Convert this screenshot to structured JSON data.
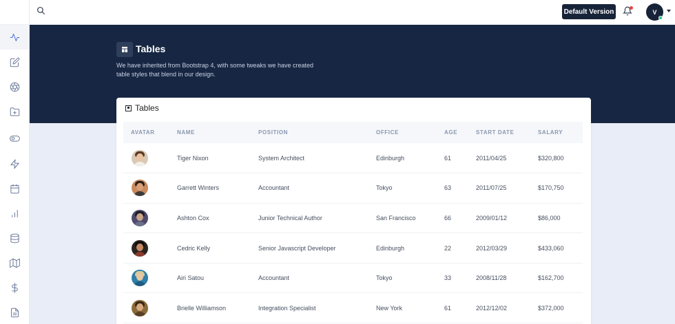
{
  "header": {
    "version_label": "Default Version",
    "user_initial": "V"
  },
  "sidebar": {
    "items": [
      {
        "icon": "activity-icon",
        "active": true
      },
      {
        "icon": "edit-icon"
      },
      {
        "icon": "aperture-icon"
      },
      {
        "icon": "folder-plus-icon"
      },
      {
        "icon": "toggle-icon"
      },
      {
        "icon": "zap-icon"
      },
      {
        "icon": "calendar-icon"
      },
      {
        "icon": "bar-chart-icon"
      },
      {
        "icon": "database-icon"
      },
      {
        "icon": "map-icon"
      },
      {
        "icon": "dollar-icon"
      },
      {
        "icon": "file-text-icon"
      }
    ]
  },
  "hero": {
    "title": "Tables",
    "description": "We have inherited from Bootstrap 4, with some tweaks we have created table styles that blend in our design."
  },
  "card": {
    "title": "Tables"
  },
  "table": {
    "columns": [
      "AVATAR",
      "NAME",
      "POSITION",
      "OFFICE",
      "AGE",
      "START DATE",
      "SALARY"
    ],
    "rows": [
      {
        "name": "Tiger Nixon",
        "position": "System Architect",
        "office": "Edinburgh",
        "age": "61",
        "start": "2011/04/25",
        "salary": "$320,800"
      },
      {
        "name": "Garrett Winters",
        "position": "Accountant",
        "office": "Tokyo",
        "age": "63",
        "start": "2011/07/25",
        "salary": "$170,750"
      },
      {
        "name": "Ashton Cox",
        "position": "Junior Technical Author",
        "office": "San Francisco",
        "age": "66",
        "start": "2009/01/12",
        "salary": "$86,000"
      },
      {
        "name": "Cedric Kelly",
        "position": "Senior Javascript Developer",
        "office": "Edinburgh",
        "age": "22",
        "start": "2012/03/29",
        "salary": "$433,060"
      },
      {
        "name": "Airi Satou",
        "position": "Accountant",
        "office": "Tokyo",
        "age": "33",
        "start": "2008/11/28",
        "salary": "$162,700"
      },
      {
        "name": "Brielle Williamson",
        "position": "Integration Specialist",
        "office": "New York",
        "age": "61",
        "start": "2012/12/02",
        "salary": "$372,000"
      }
    ]
  },
  "colors": {
    "navy": "#172743",
    "accent": "#4a6bd8",
    "notification": "#e64545",
    "online": "#2bc48a"
  }
}
